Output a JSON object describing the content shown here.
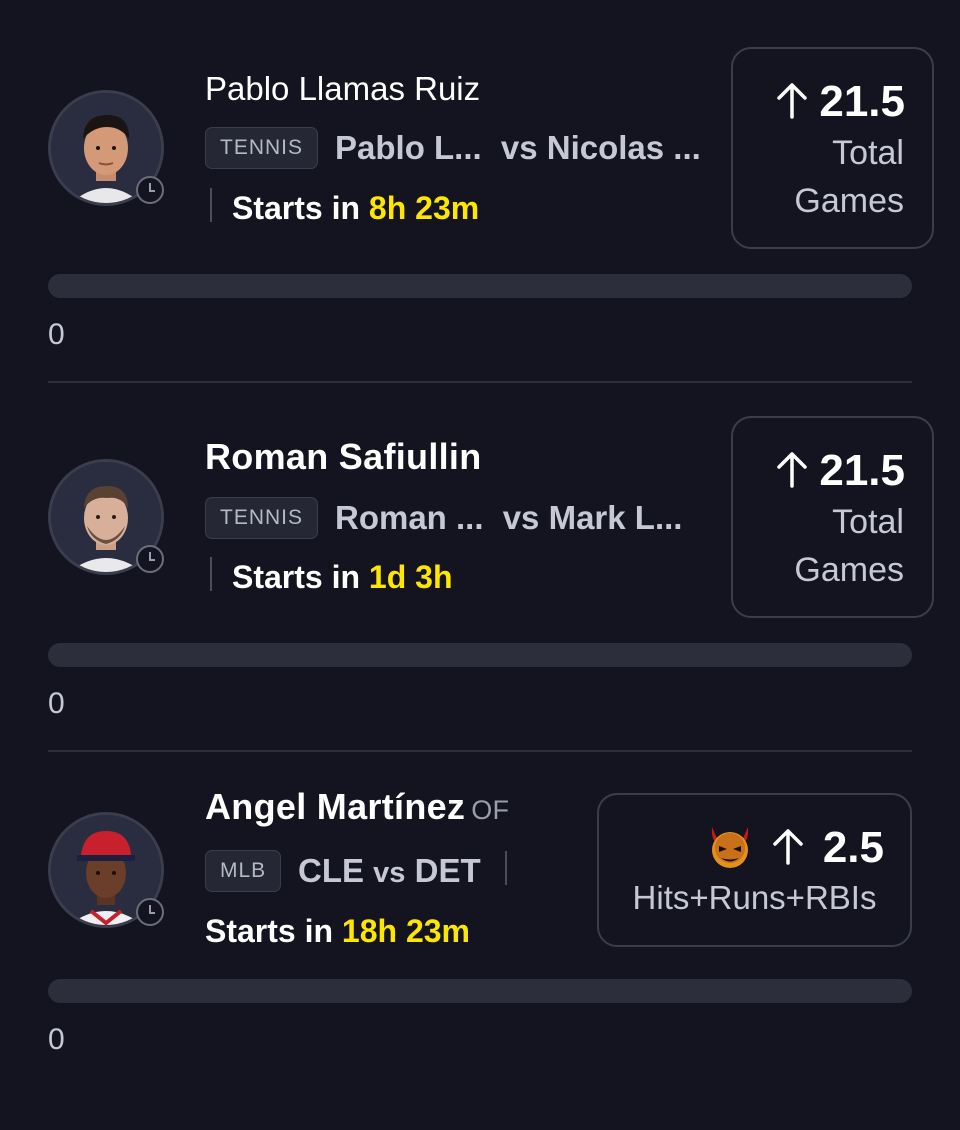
{
  "cards": [
    {
      "player_name": "Pablo Llamas Ruiz",
      "sport_tag": "TENNIS",
      "team": "Pablo L...",
      "opponent": "vs Nicolas ...",
      "starts_label": "Starts in",
      "starts_time": "8h 23m",
      "line": "21.5",
      "stat_line1": "Total",
      "stat_line2": "Games",
      "progress": 0,
      "count": "0"
    },
    {
      "player_name": "Roman Safiullin",
      "sport_tag": "TENNIS",
      "team": "Roman ...",
      "opponent": "vs Mark L...",
      "starts_label": "Starts in",
      "starts_time": "1d 3h",
      "line": "21.5",
      "stat_line1": "Total",
      "stat_line2": "Games",
      "progress": 0,
      "count": "0"
    },
    {
      "player_name": "Angel Martínez",
      "position": "OF",
      "sport_tag": "MLB",
      "team": "CLE",
      "opponent": "vs",
      "opponent_team": "DET",
      "starts_label": "Starts in",
      "starts_time": "18h 23m",
      "line": "2.5",
      "stat": "Hits+Runs+RBIs",
      "progress": 0,
      "count": "0"
    }
  ],
  "colors": {
    "background": "#13141f",
    "accent_time": "#ffe600",
    "card_border": "#3a3d4c",
    "muted_text": "#c6c9d4"
  },
  "icons": [
    "clock-icon",
    "arrow-up-icon",
    "demon-icon"
  ]
}
